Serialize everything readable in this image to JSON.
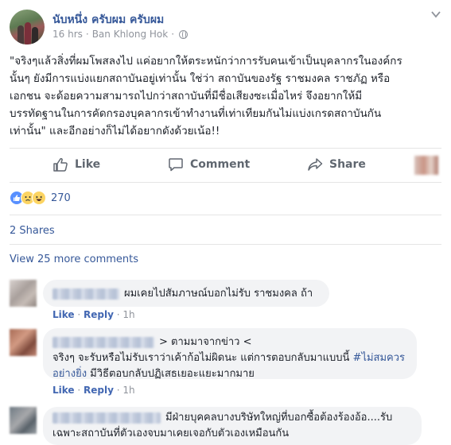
{
  "post": {
    "author": "นับหนึ่ง ครับผม ครับผม",
    "time": "16 hrs",
    "separator": "·",
    "location": "Ban Khlong Hok",
    "text_lines": [
      "\"จริงๆแล้วสิ่งที่ผมโพสลงไป แค่อยากให้ตระหนักว่าการรับคนเข้าเป็นบุคลากรในองค์กร",
      "นั้นๆ ยังมีการแบ่งแยกสถาบันอยู่เท่านั้น ใช่ว่า สถาบันของรัฐ ราชมงคล ราชภัฏ หรือ",
      "เอกชน จะด้อยความสามารถไปกว่าสถาบันที่มีชื่อเสียงซะเมื่อไหร่ จึงอยากให้มี",
      "บรรทัดฐานในการคัดกรองบุคลากรเข้าทำงานที่เท่าเทียมกันไม่แบ่งเกรดสถาบันกัน",
      "เท่านั้น\" และอีกอย่างก็ไม่ได้อยากดังด้วยเน้อ!!"
    ]
  },
  "actions": {
    "like": "Like",
    "comment": "Comment",
    "share": "Share"
  },
  "reactions": {
    "count": "270",
    "types": [
      "like-icon",
      "sad-icon",
      "haha-icon"
    ]
  },
  "shares_label": "2 Shares",
  "view_more_comments": "View 25 more comments",
  "comments": [
    {
      "text": "ผมเคยไปสัมภาษณ์บอกไม่รับ ราชมงคล ถ้า",
      "like": "Like",
      "reply": "Reply",
      "time": "1h"
    },
    {
      "forwarded": "> ตามมาจากข่าว <",
      "line1": "จริงๆ จะรับหรือไม่รับเราว่าเค้าก้อไม่ผิดนะ แต่การตอบกลับมาแบบนี้ ",
      "hashtag": "#ไม่สมควร",
      "hashtag2": "อย่างยิ่ง",
      "line2_rest": " มีวิธีตอบกลับปฏิเสธเยอะแยะมากมาย",
      "like": "Like",
      "reply": "Reply",
      "time": "1h"
    },
    {
      "line1": "มีฝ่ายบุคคลบางบริษัทใหญ่ที่บอกซื้อต้องร้องอ้อ....รับ",
      "line2": "เฉพาะสถาบันที่ตัวเองจบมาเคยเจอกับตัวเองเหมือนกัน"
    }
  ],
  "colors": {
    "link": "#365899",
    "muted": "#90949c",
    "bubble": "#f2f3f5",
    "like_blue": "#5890ff"
  }
}
